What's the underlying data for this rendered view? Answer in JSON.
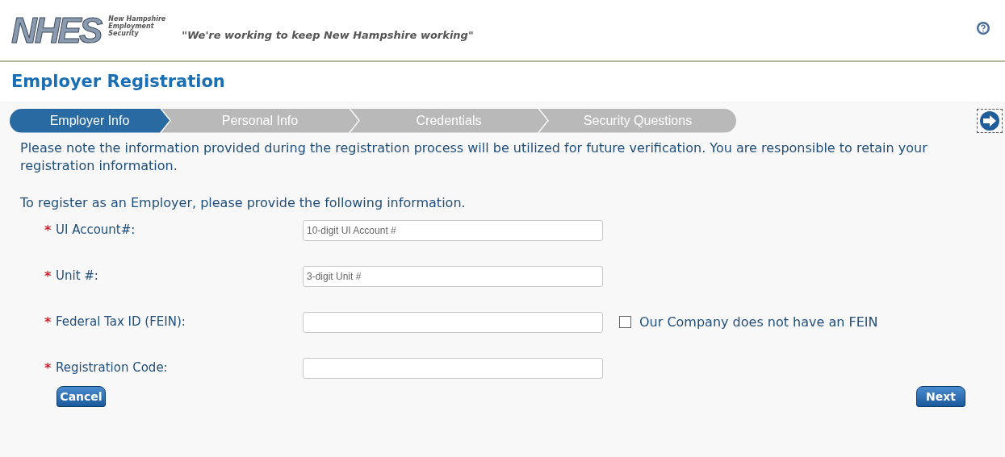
{
  "header": {
    "logo_text": "NHES",
    "agency_lines": [
      "New Hampshire",
      "Employment",
      "Security"
    ],
    "slogan": "\"We're working to keep New Hampshire working\""
  },
  "page_title": "Employer Registration",
  "steps": [
    {
      "label": "Employer Info",
      "selected": true
    },
    {
      "label": "Personal Info",
      "selected": false
    },
    {
      "label": "Credentials",
      "selected": false
    },
    {
      "label": "Security Questions",
      "selected": false
    }
  ],
  "notice": "Please note the information provided during the registration process will be utilized for future verification. You are responsible to retain your registration information.",
  "intro": "To register as an Employer, please provide the following information.",
  "fields": [
    {
      "required_mark": "*",
      "label": "UI Account#:",
      "placeholder": "10-digit UI Account #"
    },
    {
      "required_mark": "*",
      "label": "Unit #:",
      "placeholder": "3-digit Unit #"
    },
    {
      "required_mark": "*",
      "label": "Federal Tax ID (FEIN):",
      "checkbox": {
        "label": "Our Company does not have an FEIN",
        "checked": false
      }
    },
    {
      "required_mark": "*",
      "label": "Registration Code:"
    }
  ],
  "buttons": {
    "cancel": "Cancel",
    "next": "Next"
  }
}
